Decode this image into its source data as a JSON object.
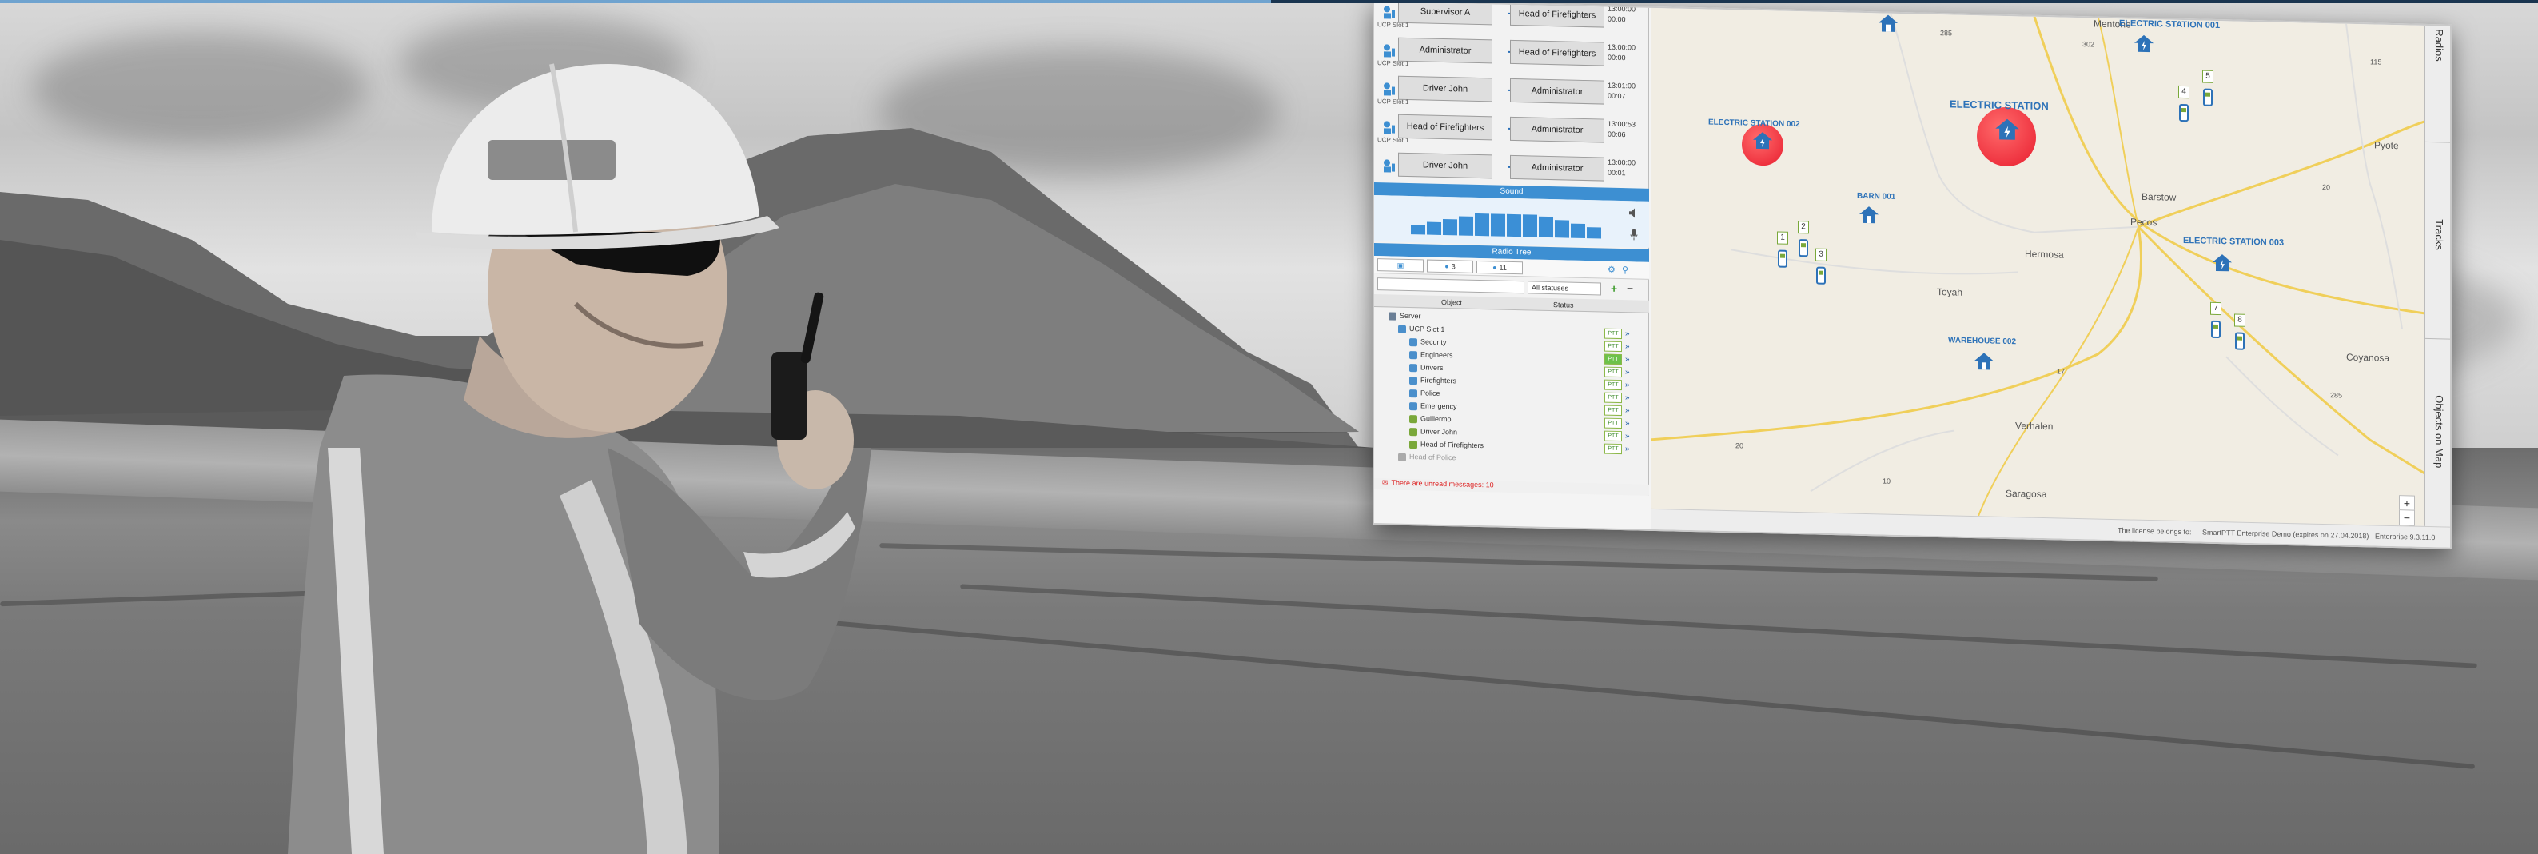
{
  "calls": [
    {
      "from": "Supervisor A",
      "to": "Head of Firefighters",
      "time": "13:00:00",
      "dur": "00:00",
      "sub": "UCP Slot 1"
    },
    {
      "from": "Administrator",
      "to": "Head of Firefighters",
      "time": "13:00:00",
      "dur": "00:00",
      "sub": "UCP Slot 1"
    },
    {
      "from": "Driver John",
      "to": "Administrator",
      "time": "13:01:00",
      "dur": "00:07",
      "sub": "UCP Slot 1"
    },
    {
      "from": "Head of Firefighters",
      "to": "Administrator",
      "time": "13:00:53",
      "dur": "00:06",
      "sub": "UCP Slot 1"
    },
    {
      "from": "Driver John",
      "to": "Administrator",
      "time": "13:00:00",
      "dur": "00:01",
      "sub": ""
    }
  ],
  "sound": {
    "header": "Sound"
  },
  "radio_tree": {
    "header": "Radio Tree",
    "tabs": [
      "",
      "3",
      "11"
    ],
    "filter_select": "All statuses",
    "columns": {
      "object": "Object",
      "status": "Status"
    },
    "root": "Server",
    "group": "UCP Slot 1",
    "items": [
      "Security",
      "Engineers",
      "Drivers",
      "Firefighters",
      "Police",
      "Emergency",
      "Guillermo",
      "Driver John",
      "Head of Firefighters",
      "Head of Police"
    ],
    "ptt_label": "PTT",
    "chevron": "»"
  },
  "footer_message": "There are unread messages: 10",
  "map": {
    "towns": [
      "Mentone",
      "Pyote",
      "Barstow",
      "Pecos",
      "Hermosa",
      "Toyah",
      "Verhalen",
      "Coyanosa",
      "Saragosa"
    ],
    "roads": [
      "285",
      "302",
      "115",
      "20",
      "17",
      "285",
      "20",
      "10"
    ],
    "pois": [
      {
        "name": "ELECTRIC STATION 001"
      },
      {
        "name": "ELECTRIC STATION 002"
      },
      {
        "name": "ELECTRIC STATION"
      },
      {
        "name": "ELECTRIC STATION 003"
      },
      {
        "name": "BARN 001"
      },
      {
        "name": "WAREHOUSE 002"
      }
    ],
    "badges": [
      "1",
      "2",
      "3",
      "4",
      "5",
      "7",
      "8"
    ],
    "zoom_in": "+",
    "zoom_out": "−"
  },
  "rail_tabs": [
    "Radios",
    "Tracks",
    "Objects on Map"
  ],
  "status_bar": {
    "license": "The license belongs to:",
    "product": "SmartPTT Enterprise Demo (expires on 27.04.2018)",
    "version": "Enterprise 9.3.11.0"
  },
  "colors": {
    "accent": "#3d8fd2",
    "alert": "#e81c2e",
    "ptt": "#6cc24a"
  }
}
